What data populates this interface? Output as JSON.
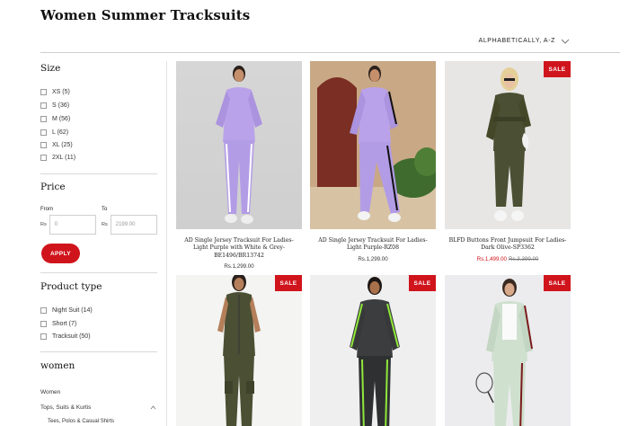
{
  "page": {
    "title": "Women Summer Tracksuits"
  },
  "sort": {
    "label": "ALPHABETICALLY, A-Z"
  },
  "filters": {
    "size": {
      "title": "Size",
      "options": [
        "XS (5)",
        "S (36)",
        "M (56)",
        "L (62)",
        "XL (25)",
        "2XL (11)"
      ]
    },
    "price": {
      "title": "Price",
      "from_label": "From",
      "to_label": "To",
      "currency": "Rs",
      "from_placeholder": "0",
      "to_placeholder": "2199.00",
      "apply_label": "APPLY"
    },
    "product_type": {
      "title": "Product type",
      "options": [
        "Night Suit (14)",
        "Short (7)",
        "Tracksuit (50)"
      ]
    },
    "women": {
      "title": "women",
      "links": [
        "Women",
        "Tops, Suits & Kurtis",
        "Tees, Polos & Casual Shirts"
      ]
    }
  },
  "products": [
    {
      "name": "AD Single Jersey Tracksuit For Ladies-Light Purple with White & Grey-BE1496/BR13742",
      "price": "Rs.1,299.00",
      "sale": false,
      "sale_badge": ""
    },
    {
      "name": "AD Single Jersey Tracksuit For Ladies-Light Purple-RZ08",
      "price": "Rs.1,299.00",
      "sale": false,
      "sale_badge": ""
    },
    {
      "name": "BLFD Buttons Front Jumpsuit For Ladies-Dark Olive-SP3362",
      "price": "Rs.1,499.00",
      "original_price": "Rs.3,399.00",
      "sale": true,
      "sale_badge": "SALE"
    },
    {
      "name": "",
      "price": "",
      "sale": true,
      "sale_badge": "SALE"
    },
    {
      "name": "",
      "price": "",
      "sale": true,
      "sale_badge": "SALE"
    },
    {
      "name": "",
      "price": "",
      "sale": true,
      "sale_badge": "SALE"
    }
  ],
  "colors": {
    "accent": "#d0141c",
    "lavender": "#b9a2ea",
    "olive": "#4b4f33"
  }
}
